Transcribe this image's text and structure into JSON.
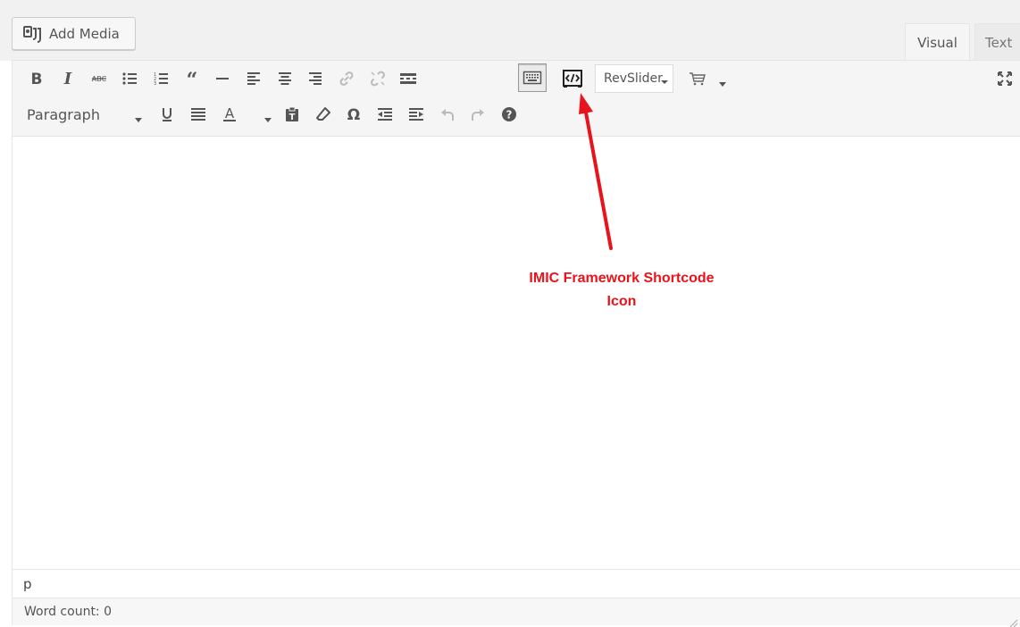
{
  "header": {
    "add_media_label": "Add Media",
    "tabs": [
      {
        "label": "Visual",
        "selected": true
      },
      {
        "label": "Text",
        "selected": false
      }
    ]
  },
  "toolbar": {
    "row1": [
      {
        "name": "bold-button",
        "icon": "bold-icon"
      },
      {
        "name": "italic-button",
        "icon": "italic-icon"
      },
      {
        "name": "strikethrough-button",
        "icon": "strikethrough-icon"
      },
      {
        "name": "bulleted-list-button",
        "icon": "bulleted-list-icon"
      },
      {
        "name": "numbered-list-button",
        "icon": "numbered-list-icon"
      },
      {
        "name": "blockquote-button",
        "icon": "blockquote-icon"
      },
      {
        "name": "horizontal-line-button",
        "icon": "horizontal-line-icon"
      },
      {
        "name": "align-left-button",
        "icon": "align-left-icon"
      },
      {
        "name": "align-center-button",
        "icon": "align-center-icon"
      },
      {
        "name": "align-right-button",
        "icon": "align-right-icon"
      },
      {
        "name": "insert-link-button",
        "icon": "link-icon"
      },
      {
        "name": "remove-link-button",
        "icon": "unlink-icon"
      },
      {
        "name": "read-more-button",
        "icon": "read-more-icon"
      },
      {
        "name": "toolbar-toggle-button",
        "icon": "keyboard-icon",
        "active": true
      },
      {
        "name": "imic-shortcode-button",
        "icon": "shortcode-icon"
      },
      {
        "name": "cart-button",
        "icon": "cart-icon"
      },
      {
        "name": "fullscreen-button",
        "icon": "fullscreen-icon"
      }
    ],
    "revslider_label": "RevSlider",
    "paragraph_format": "Paragraph",
    "row2": [
      {
        "name": "underline-button",
        "icon": "underline-icon"
      },
      {
        "name": "justify-button",
        "icon": "justify-icon"
      },
      {
        "name": "text-color-button",
        "icon": "text-color-icon"
      },
      {
        "name": "paste-as-text-button",
        "icon": "paste-text-icon"
      },
      {
        "name": "clear-formatting-button",
        "icon": "eraser-icon"
      },
      {
        "name": "special-character-button",
        "icon": "omega-icon"
      },
      {
        "name": "decrease-indent-button",
        "icon": "outdent-icon"
      },
      {
        "name": "increase-indent-button",
        "icon": "indent-icon"
      },
      {
        "name": "undo-button",
        "icon": "undo-icon"
      },
      {
        "name": "redo-button",
        "icon": "redo-icon"
      },
      {
        "name": "help-button",
        "icon": "help-icon"
      }
    ]
  },
  "editor": {
    "content": ""
  },
  "status": {
    "path": "p",
    "word_count": "Word count: 0"
  },
  "annotation": {
    "line1": "IMIC Framework Shortcode",
    "line2": "Icon",
    "color": "#e8141b"
  },
  "colors": {
    "icon": "#555555",
    "icon_disabled": "#bbbbbb",
    "toolbar_bg": "#f5f5f5",
    "border": "#e5e5e5"
  }
}
